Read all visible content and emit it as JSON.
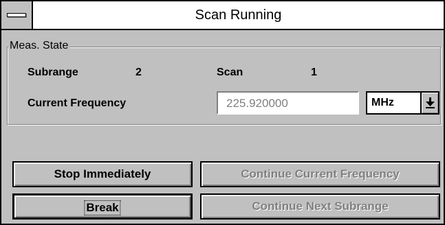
{
  "window": {
    "title": "Scan Running"
  },
  "group": {
    "label": "Meas. State"
  },
  "subrange": {
    "label": "Subrange",
    "value": "2"
  },
  "scan": {
    "label": "Scan",
    "value": "1"
  },
  "frequency": {
    "label": "Current Frequency",
    "value": "225.920000",
    "unit": "MHz"
  },
  "buttons": {
    "stop_immediately": "Stop Immediately",
    "continue_current": "Continue Current Frequency",
    "break": "Break",
    "continue_next": "Continue Next Subrange"
  },
  "icons": {
    "system_menu": "system-menu-icon",
    "dropdown": "dropdown-arrow-icon"
  }
}
